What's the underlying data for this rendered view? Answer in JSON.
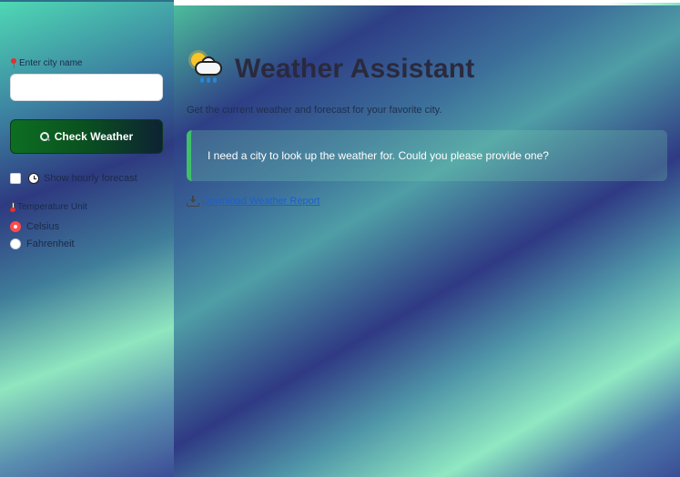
{
  "sidebar": {
    "city_label": "Enter city name",
    "city_value": "",
    "city_placeholder": "",
    "check_button_label": "Check Weather",
    "hourly_checkbox_label": "Show hourly forecast",
    "hourly_checked": false,
    "unit_label": "Temperature Unit",
    "unit_options": [
      "Celsius",
      "Fahrenheit"
    ],
    "unit_selected": "Celsius"
  },
  "main": {
    "title": "Weather Assistant",
    "title_icon": "sun-behind-rain-cloud-icon",
    "subtitle": "Get the current weather and forecast for your favorite city.",
    "alert_message": "I need a city to look up the weather for. Could you please provide one?",
    "download_link_label": "Download Weather Report"
  },
  "colors": {
    "button_start": "#0d6e22",
    "button_end": "#0e2233",
    "radio_selected": "#ff4b4b",
    "alert_border": "#3fbf6a",
    "link": "#1d5fd0"
  },
  "icons": {
    "city_label": "pin-icon",
    "check_button": "magnifier-icon",
    "hourly": "clock-icon",
    "unit": "thermometer-icon",
    "download": "inbox-tray-icon"
  }
}
